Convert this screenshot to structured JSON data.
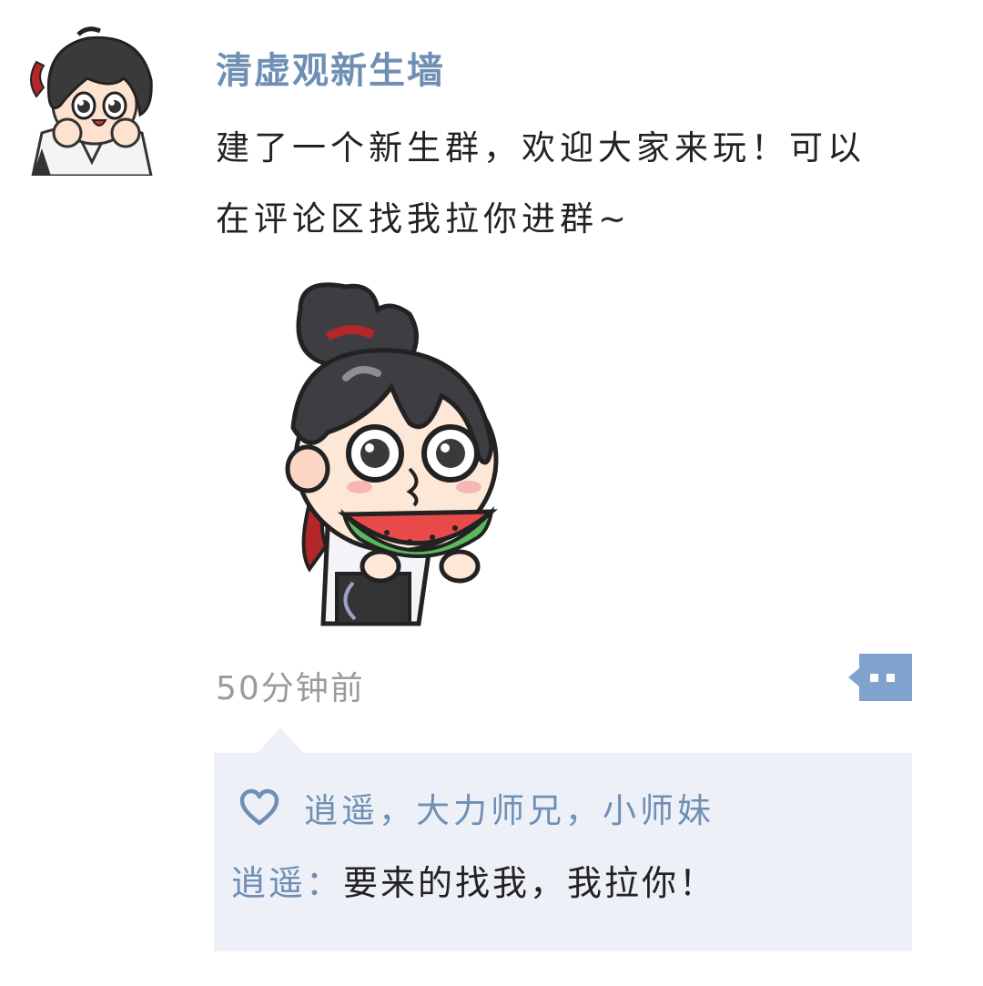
{
  "post": {
    "author": "清虚观新生墙",
    "text_lines": [
      "建了一个新生群，欢迎大家来玩！可以",
      "在评论区找我拉你进群~"
    ],
    "timestamp": "50分钟前",
    "more_icon": "comment-more-icon"
  },
  "interactions": {
    "like_icon": "heart-icon",
    "likes": "逍遥，大力师兄，小师妹",
    "comments": [
      {
        "author": "逍遥",
        "separator": "：",
        "text": "要来的找我，我拉你！"
      }
    ]
  },
  "colors": {
    "link_blue": "#6f8fb5",
    "text_dark": "#222222",
    "timestamp_gray": "#9b9b9b",
    "comment_box_bg": "#eef0f7",
    "more_button_bg": "#7fa3cc"
  }
}
